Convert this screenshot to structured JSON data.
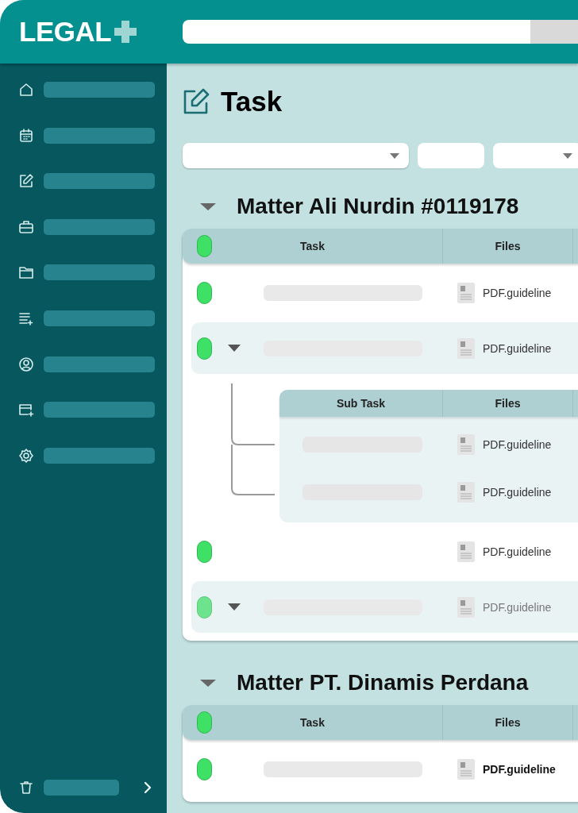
{
  "header": {
    "logo": "LEGAL"
  },
  "sidebar": {
    "items": [
      {
        "kind": "home"
      },
      {
        "kind": "calendar"
      },
      {
        "kind": "edit"
      },
      {
        "kind": "briefcase"
      },
      {
        "kind": "folder"
      },
      {
        "kind": "list"
      },
      {
        "kind": "user"
      },
      {
        "kind": "card"
      },
      {
        "kind": "settings"
      }
    ],
    "footer": {
      "kind": "trash"
    }
  },
  "page": {
    "title": "Task"
  },
  "filters": [
    {
      "kind": "dropdown"
    },
    {
      "kind": "field"
    },
    {
      "kind": "dropdown"
    }
  ],
  "matters": [
    {
      "title": "Matter Ali Nurdin #0119178",
      "expanded": true,
      "columns": [
        "Task",
        "Files"
      ],
      "rows": [
        {
          "kind": "task",
          "title_bar": true,
          "disabled": false,
          "bold": false,
          "file": "PDF.guideline"
        },
        {
          "kind": "group",
          "title_bar": true,
          "disabled": false,
          "bold": false,
          "file": "PDF.guideline",
          "subtasks": {
            "columns": [
              "Sub Task",
              "Files"
            ],
            "rows": [
              {
                "file": "PDF.guideline"
              },
              {
                "file": "PDF.guideline"
              }
            ]
          }
        },
        {
          "kind": "task",
          "title_bar": false,
          "disabled": false,
          "bold": false,
          "file": "PDF.guideline"
        },
        {
          "kind": "group",
          "title_bar": true,
          "disabled": true,
          "bold": false,
          "file": "PDF.guideline"
        }
      ]
    },
    {
      "title": "Matter PT. Dinamis Perdana",
      "expanded": true,
      "columns": [
        "Task",
        "Files"
      ],
      "rows": [
        {
          "kind": "task",
          "title_bar": true,
          "disabled": false,
          "bold": true,
          "file": "PDF.guideline"
        }
      ]
    }
  ]
}
